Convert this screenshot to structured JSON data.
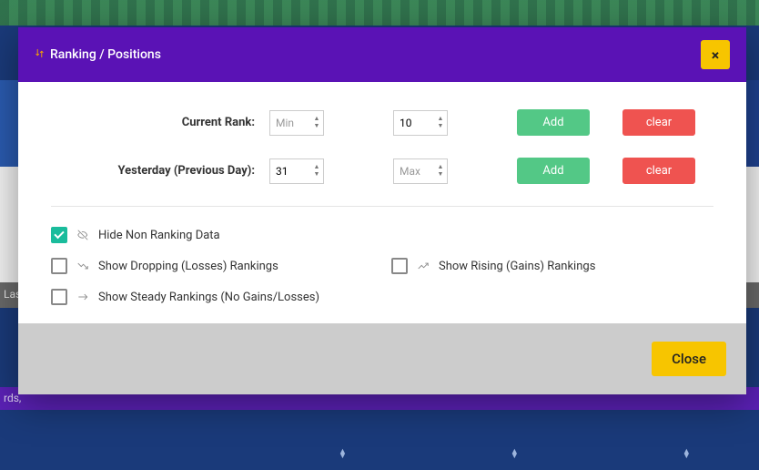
{
  "modal": {
    "title": "Ranking / Positions",
    "close_x": "×"
  },
  "filters": {
    "current": {
      "label": "Current Rank:",
      "min_placeholder": "Min",
      "min_value": "",
      "max_placeholder": "Max",
      "max_value": "10",
      "add": "Add",
      "clear": "clear"
    },
    "yesterday": {
      "label": "Yesterday (Previous Day):",
      "min_placeholder": "Min",
      "min_value": "31",
      "max_placeholder": "Max",
      "max_value": "",
      "add": "Add",
      "clear": "clear"
    }
  },
  "options": {
    "hide_non_ranking": {
      "label": "Hide Non Ranking Data",
      "checked": true
    },
    "show_dropping": {
      "label": "Show Dropping (Losses) Rankings",
      "checked": false
    },
    "show_rising": {
      "label": "Show Rising (Gains) Rankings",
      "checked": false
    },
    "show_steady": {
      "label": "Show Steady Rankings (No Gains/Losses)",
      "checked": false
    }
  },
  "footer": {
    "close": "Close"
  },
  "background": {
    "last_text": "Las",
    "purple_text": "rds,"
  }
}
